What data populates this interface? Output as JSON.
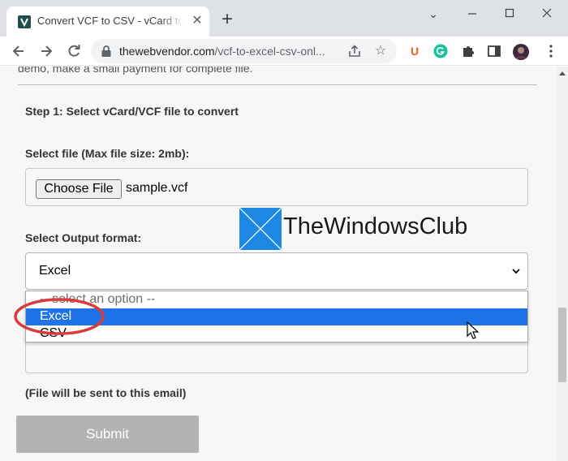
{
  "browser": {
    "tab_title": "Convert VCF to CSV - vCard to CSV",
    "tab_close_icon": "close-icon",
    "new_tab_icon": "plus-icon",
    "window_controls": [
      "chevron-down-icon",
      "minimize-icon",
      "maximize-icon",
      "close-icon"
    ],
    "url_host": "thewebvendor.com",
    "url_path": "/vcf-to-excel-csv-onl...",
    "extension_u_label": "U",
    "extensions": [
      "ublock-icon",
      "grammarly-icon",
      "puzzle-icon",
      "sidepanel-icon",
      "avatar",
      "kebab-menu-icon"
    ]
  },
  "page": {
    "cut_text": "demo, make a small payment for complete file.",
    "step1_label": "Step 1: Select vCard/VCF file to convert",
    "file_label": "Select file (Max file size: 2mb):",
    "choose_file_label": "Choose File",
    "file_name": "sample.vcf",
    "output_label": "Select Output format:",
    "select_value": "Excel",
    "options": [
      "-- select an option --",
      "Excel",
      "CSV"
    ],
    "email_note": "(File will be sent to this email)",
    "submit_label": "Submit"
  },
  "watermark": {
    "text": "TheWindowsClub"
  },
  "colors": {
    "highlight": "#1e73e8",
    "annotation": "#d93b3b",
    "submit_bg": "#b3b3b3",
    "tab_strip": "#dee1e6"
  }
}
